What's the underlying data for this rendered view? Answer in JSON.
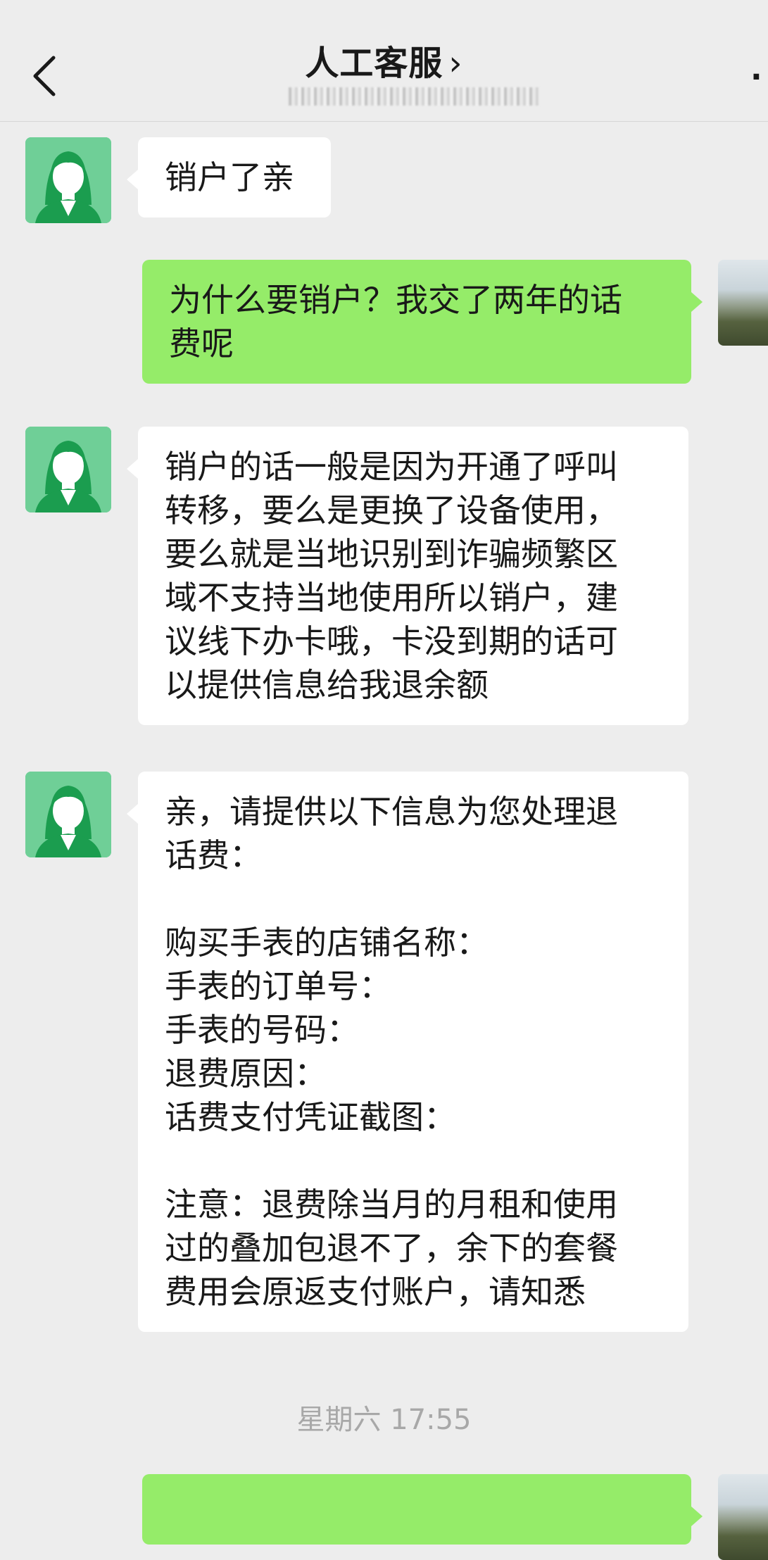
{
  "header": {
    "back_icon": "chevron-left-icon",
    "title": "人工客服",
    "title_chevron": "›",
    "more_icon": "more-dots-icon"
  },
  "messages": [
    {
      "sender": "agent",
      "text": "销户了亲"
    },
    {
      "sender": "user",
      "text": "为什么要销户？我交了两年的话\n费呢"
    },
    {
      "sender": "agent",
      "text": "销户的话一般是因为开通了呼叫\n转移，要么是更换了设备使用，\n要么就是当地识别到诈骗频繁区\n域不支持当地使用所以销户，建\n议线下办卡哦，卡没到期的话可\n以提供信息给我退余额"
    },
    {
      "sender": "agent",
      "text": "亲，请提供以下信息为您处理退\n话费：\n\n购买手表的店铺名称：\n手表的订单号：\n手表的号码：\n退费原因：\n话费支付凭证截图：\n\n注意：退费除当月的月租和使用\n过的叠加包退不了，余下的套餐\n费用会原返支付账户，请知悉"
    },
    {
      "sender": "user",
      "text": ""
    }
  ],
  "timestamp": "星期六 17:55",
  "colors": {
    "background": "#ededed",
    "outgoing_bubble": "#95ec69",
    "incoming_bubble": "#ffffff",
    "agent_avatar": "#6fcf97"
  }
}
